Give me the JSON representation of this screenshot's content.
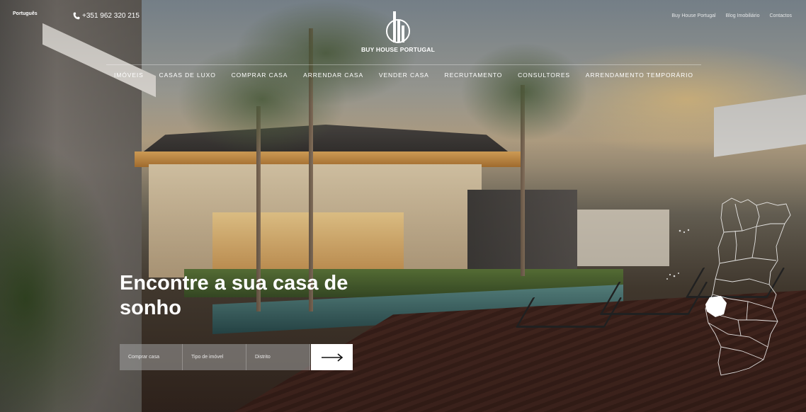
{
  "header": {
    "language": "Português",
    "phone": "+351 962 320 215",
    "logo_text": "BUY HOUSE PORTUGAL",
    "top_links": [
      "Buy House Portugal",
      "Blog Imobiliário",
      "Contactos"
    ]
  },
  "nav": {
    "items": [
      "IMÓVEIS",
      "CASAS DE LUXO",
      "COMPRAR CASA",
      "ARRENDAR CASA",
      "VENDER CASA",
      "RECRUTAMENTO",
      "CONSULTORES",
      "ARRENDAMENTO TEMPORÁRIO"
    ]
  },
  "hero": {
    "headline": "Encontre a sua casa de sonho"
  },
  "search": {
    "fields": [
      "Comprar casa",
      "Tipo de imóvel",
      "Distrito"
    ],
    "submit_icon": "arrow-right-icon"
  },
  "map": {
    "icon": "portugal-districts-map-icon",
    "highlight_color": "#ffffff"
  }
}
